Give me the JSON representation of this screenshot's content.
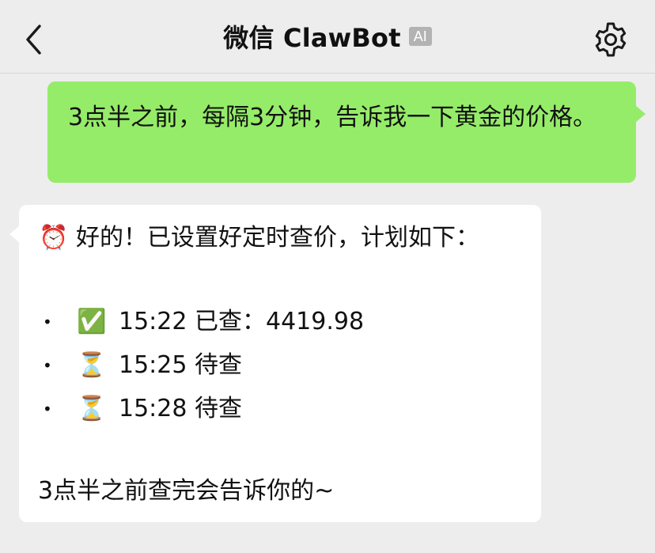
{
  "header": {
    "back_icon": "chevron-left-icon",
    "title": "微信 ClawBot",
    "badge": "AI",
    "settings_icon": "gear-icon"
  },
  "messages": {
    "user": {
      "text": "3点半之前，每隔3分钟，告诉我一下黄金的价格。",
      "bubble_color": "#95ec69"
    },
    "bot": {
      "intro_emoji": "⏰",
      "intro_text": "好的！已设置好定时查价，计划如下：",
      "items": [
        {
          "bullet": "•",
          "emoji": "✅",
          "text": "15:22 已查：4419.98"
        },
        {
          "bullet": "•",
          "emoji": "⏳",
          "text": "15:25 待查"
        },
        {
          "bullet": "•",
          "emoji": "⏳",
          "text": "15:28 待查"
        }
      ],
      "outro": "3点半之前查完会告诉你的~",
      "bubble_color": "#ffffff"
    }
  },
  "colors": {
    "background": "#ededed",
    "badge": "#b3b3b3"
  }
}
